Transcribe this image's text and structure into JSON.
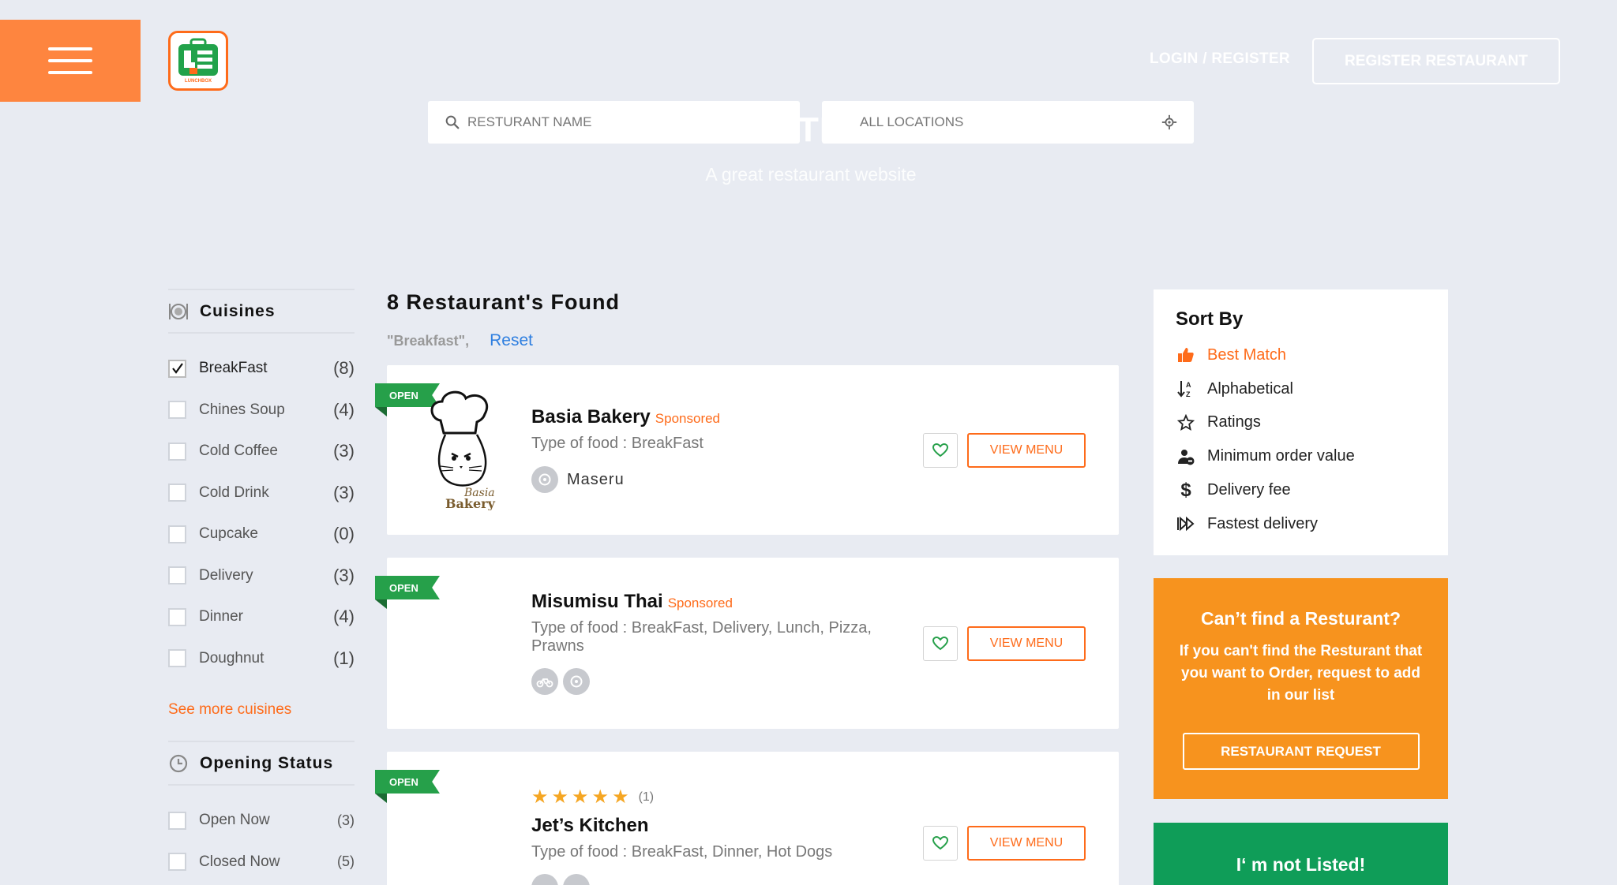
{
  "header": {
    "login_label": "LOGIN / REGISTER",
    "register_restaurant_label": "REGISTER RESTAURANT",
    "logo_text": "LUNCHBOX"
  },
  "hero": {
    "title_fragment": "TI",
    "subtitle": "A great restaurant website"
  },
  "search": {
    "name_placeholder": "RESTURANT NAME",
    "location_placeholder": "ALL LOCATIONS"
  },
  "sidebar": {
    "cuisines_title": "Cuisines",
    "cuisines": [
      {
        "label": "BreakFast",
        "count": "(8)",
        "checked": true
      },
      {
        "label": "Chines Soup",
        "count": "(4)",
        "checked": false
      },
      {
        "label": "Cold Coffee",
        "count": "(3)",
        "checked": false
      },
      {
        "label": "Cold Drink",
        "count": "(3)",
        "checked": false
      },
      {
        "label": "Cupcake",
        "count": "(0)",
        "checked": false
      },
      {
        "label": "Delivery",
        "count": "(3)",
        "checked": false
      },
      {
        "label": "Dinner",
        "count": "(4)",
        "checked": false
      },
      {
        "label": "Doughnut",
        "count": "(1)",
        "checked": false
      }
    ],
    "see_more_label": "See more cuisines",
    "opening_title": "Opening Status",
    "opening": [
      {
        "label": "Open Now",
        "count": "(3)"
      },
      {
        "label": "Closed Now",
        "count": "(5)"
      }
    ]
  },
  "results": {
    "title": "8 Restaurant's Found",
    "active_filter": "\"Breakfast\",",
    "reset_label": "Reset",
    "open_label": "OPEN",
    "sponsored_label": "Sponsored",
    "view_menu_label": "VIEW MENU",
    "restaurants": [
      {
        "name": "Basia Bakery",
        "sponsored": true,
        "type": "Type of food : BreakFast",
        "location": "Maseru",
        "logo_text": "Basia Bakery"
      },
      {
        "name": "Misumisu Thai",
        "sponsored": true,
        "type": "Type of food : BreakFast, Delivery, Lunch, Pizza, Prawns"
      },
      {
        "name": "Jet’s Kitchen",
        "sponsored": false,
        "type": "Type of food : BreakFast, Dinner, Hot Dogs",
        "rating_stars": 5,
        "rating_count": "(1)"
      }
    ]
  },
  "sort": {
    "title": "Sort By",
    "options": [
      {
        "label": "Best Match",
        "icon": "thumbs-up-icon",
        "active": true
      },
      {
        "label": "Alphabetical",
        "icon": "sort-alpha-icon",
        "active": false
      },
      {
        "label": "Ratings",
        "icon": "star-outline-icon",
        "active": false
      },
      {
        "label": "Minimum order value",
        "icon": "user-minus-icon",
        "active": false
      },
      {
        "label": "Delivery fee",
        "icon": "dollar-icon",
        "active": false
      },
      {
        "label": "Fastest delivery",
        "icon": "fast-forward-icon",
        "active": false
      }
    ]
  },
  "cta_request": {
    "title": "Can’t find a Resturant?",
    "body": "If you can't find the Resturant that you want to Order, request to add in our list",
    "button_label": "RESTAURANT REQUEST"
  },
  "cta_listed": {
    "title": "I‘ m not Listed!"
  },
  "colors": {
    "accent": "#fe853f",
    "orange_cta": "#f7931e",
    "green_cta": "#0f9d58",
    "open_ribbon": "#26a04a",
    "page_bg": "#e8ebf2"
  }
}
